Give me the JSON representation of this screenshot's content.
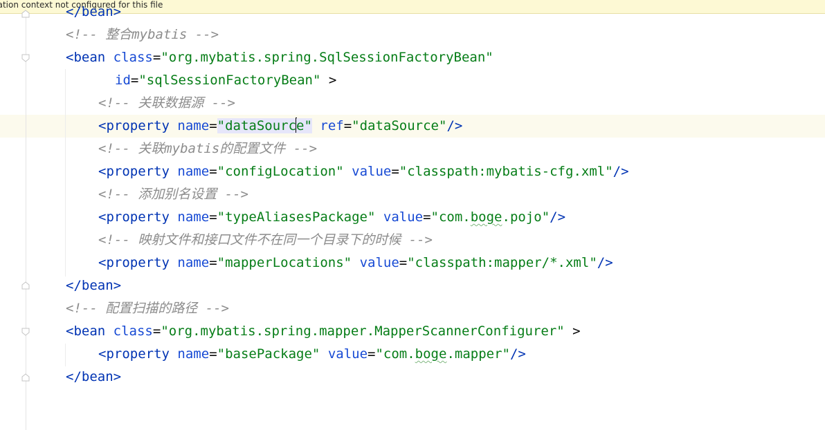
{
  "banner": {
    "text": "cation context not configured for this file"
  },
  "code": {
    "l0": {
      "tag": "</bean>"
    },
    "l1": {
      "comment": "<!-- 整合mybatis -->"
    },
    "l2": {
      "open": "<bean",
      "attr": "class",
      "eq": "=",
      "val": "\"org.mybatis.spring.SqlSessionFactoryBean\""
    },
    "l3": {
      "attr": "id",
      "eq": "=",
      "val": "\"sqlSessionFactoryBean\"",
      "close": " >"
    },
    "l4": {
      "comment": "<!-- 关联数据源 -->"
    },
    "l5": {
      "lt": "<",
      "tag": "property",
      "a1": "name",
      "eq1": "=",
      "v1a": "\"dataSour",
      "v1b": "c",
      "v1c": "e\"",
      "a2": "ref",
      "eq2": "=",
      "v2": "\"dataSource\"",
      "end": "/>"
    },
    "l6": {
      "comment": "<!-- 关联mybatis的配置文件 -->"
    },
    "l7": {
      "lt": "<",
      "tag": "property",
      "a1": "name",
      "eq1": "=",
      "v1": "\"configLocation\"",
      "a2": "value",
      "eq2": "=",
      "v2": "\"classpath:mybatis-cfg.xml\"",
      "end": "/>"
    },
    "l8": {
      "comment": "<!-- 添加别名设置 -->"
    },
    "l9": {
      "lt": "<",
      "tag": "property",
      "a1": "name",
      "eq1": "=",
      "v1": "\"typeAliasesPackage\"",
      "a2": "value",
      "eq2": "=",
      "v2a": "\"com.",
      "v2b": "boge",
      "v2c": ".pojo\"",
      "end": "/>"
    },
    "l10": {
      "comment": "<!-- 映射文件和接口文件不在同一个目录下的时候 -->"
    },
    "l11": {
      "lt": "<",
      "tag": "property",
      "a1": "name",
      "eq1": "=",
      "v1": "\"mapperLocations\"",
      "a2": "value",
      "eq2": "=",
      "v2": "\"classpath:mapper/*.xml\"",
      "end": "/>"
    },
    "l12": {
      "tag": "</bean>"
    },
    "l13": {
      "comment": "<!-- 配置扫描的路径 -->"
    },
    "l14": {
      "open": "<bean",
      "attr": "class",
      "eq": "=",
      "val": "\"org.mybatis.spring.mapper.MapperScannerConfigurer\"",
      "close": " >"
    },
    "l15": {
      "lt": "<",
      "tag": "property",
      "a1": "name",
      "eq1": "=",
      "v1": "\"basePackage\"",
      "a2": "value",
      "eq2": "=",
      "v2a": "\"com.",
      "v2b": "boge",
      "v2c": ".mapper\"",
      "end": "/>"
    },
    "l16": {
      "tag": "</bean>"
    }
  }
}
